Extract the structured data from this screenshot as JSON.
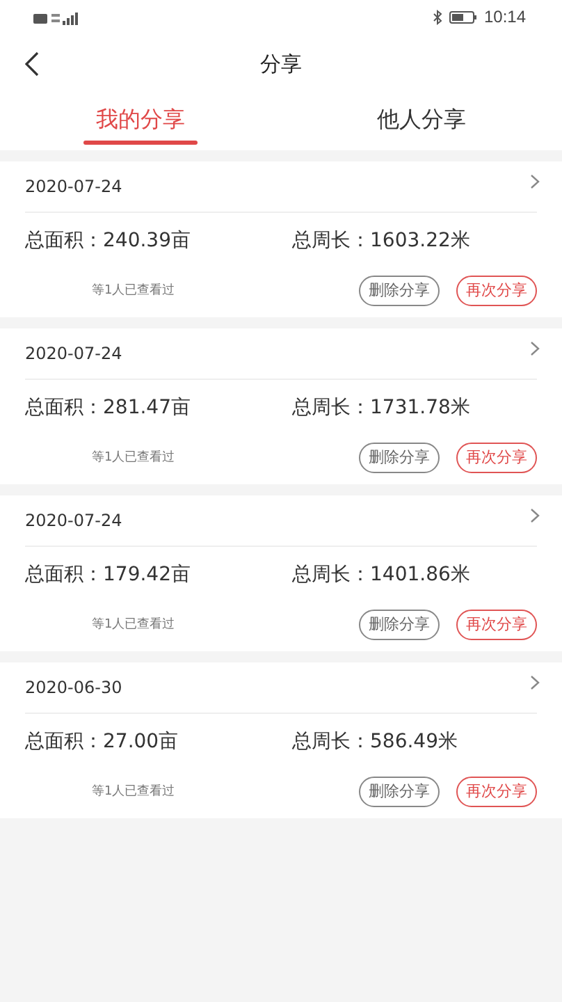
{
  "status_bar": {
    "time": "10:14"
  },
  "header": {
    "title": "分享"
  },
  "tabs": [
    {
      "label": "我的分享",
      "selected": true
    },
    {
      "label": "他人分享",
      "selected": false
    }
  ],
  "shares": [
    {
      "date": "2020-07-24",
      "area": "总面积：240.39亩",
      "perimeter": "总周长：1603.22米",
      "viewers": "等1人已查看过",
      "delete_label": "删除分享",
      "reshare_label": "再次分享"
    },
    {
      "date": "2020-07-24",
      "area": "总面积：281.47亩",
      "perimeter": "总周长：1731.78米",
      "viewers": "等1人已查看过",
      "delete_label": "删除分享",
      "reshare_label": "再次分享"
    },
    {
      "date": "2020-07-24",
      "area": "总面积：179.42亩",
      "perimeter": "总周长：1401.86米",
      "viewers": "等1人已查看过",
      "delete_label": "删除分享",
      "reshare_label": "再次分享"
    },
    {
      "date": "2020-06-30",
      "area": "总面积：27.00亩",
      "perimeter": "总周长：586.49米",
      "viewers": "等1人已查看过",
      "delete_label": "删除分享",
      "reshare_label": "再次分享"
    }
  ]
}
